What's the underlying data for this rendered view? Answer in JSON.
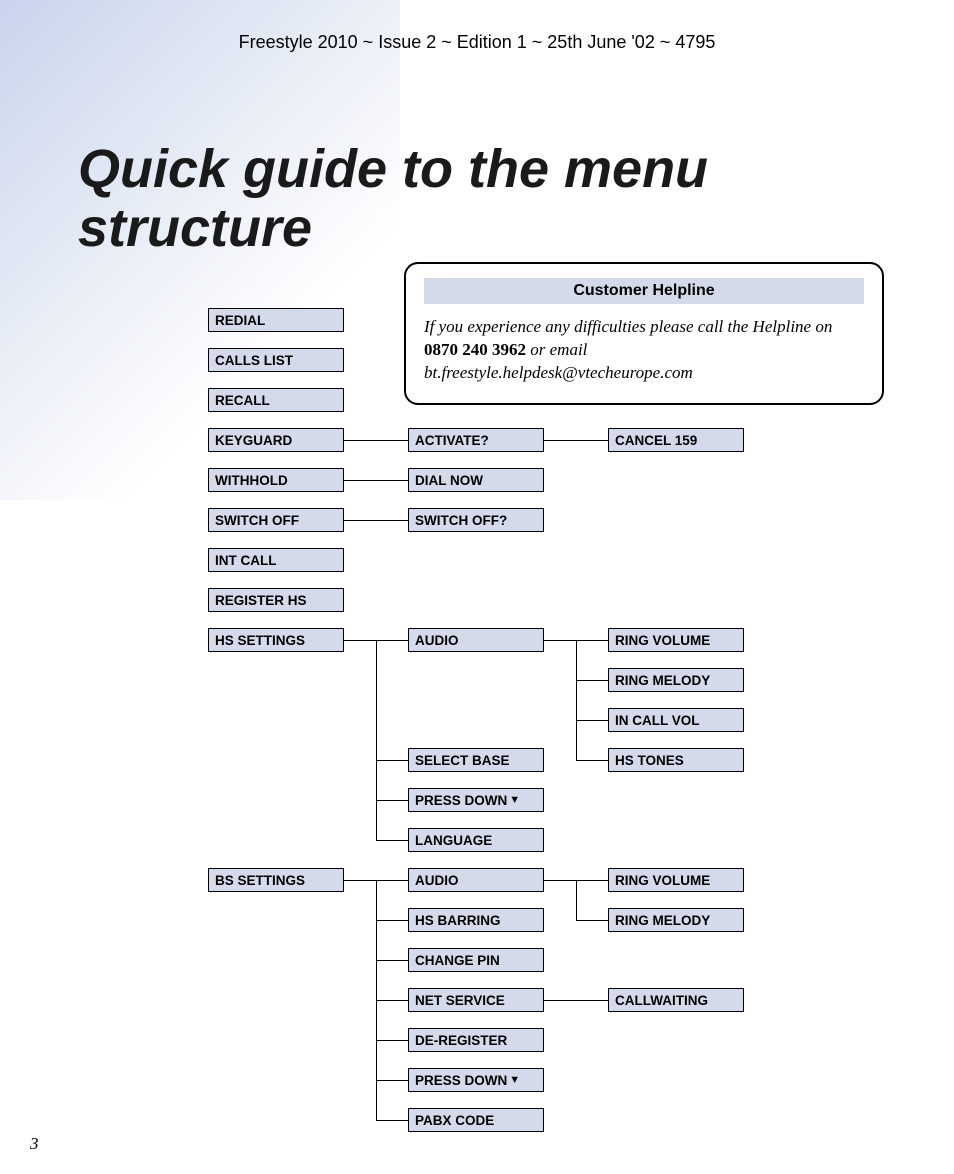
{
  "header": "Freestyle 2010 ~ Issue 2 ~ Edition 1 ~ 25th June '02 ~ 4795",
  "title": "Quick guide to the menu structure",
  "helpline": {
    "header": "Customer Helpline",
    "text_before": "If you experience any difficulties please call the Helpline on ",
    "phone": "0870 240 3962",
    "text_mid": " or email ",
    "email": "bt.freestyle.helpdesk@vtecheurope.com"
  },
  "menu": {
    "redial": "REDIAL",
    "calls_list": "CALLS LIST",
    "recall": "RECALL",
    "keyguard": "KEYGUARD",
    "activate": "ACTIVATE?",
    "cancel159": "CANCEL 159",
    "withhold": "WITHHOLD",
    "dial_now": "DIAL NOW",
    "switch_off": "SWITCH OFF",
    "switch_off_q": "SWITCH OFF?",
    "int_call": "INT CALL",
    "register_hs": "REGISTER HS",
    "hs_settings": "HS SETTINGS",
    "hs_audio": "AUDIO",
    "ring_volume": "RING VOLUME",
    "ring_melody": "RING MELODY",
    "in_call_vol": "IN CALL VOL",
    "hs_tones": "HS TONES",
    "select_base": "SELECT BASE",
    "press_down": "PRESS DOWN",
    "language": "LANGUAGE",
    "bs_settings": "BS SETTINGS",
    "bs_audio": "AUDIO",
    "bs_ring_volume": "RING VOLUME",
    "bs_ring_melody": "RING MELODY",
    "hs_barring": "HS BARRING",
    "change_pin": "CHANGE PIN",
    "net_service": "NET SERVICE",
    "callwaiting": "CALLWAITING",
    "de_register": "DE-REGISTER",
    "bs_press_down": "PRESS DOWN",
    "pabx_code": "PABX CODE"
  },
  "page_number": "3"
}
